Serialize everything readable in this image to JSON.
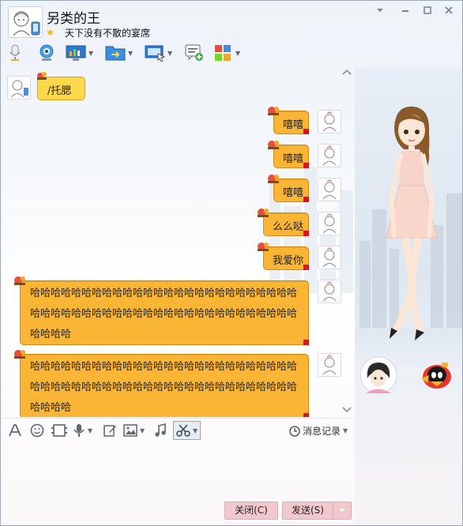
{
  "header": {
    "contact_name": "另类的王",
    "signature": "天下没有不散的宴席"
  },
  "window_controls": {
    "menu_icon": "chevron-down-icon",
    "minimize_icon": "minimize-icon",
    "maximize_icon": "maximize-icon",
    "close_icon": "close-icon"
  },
  "toolbar_icons": [
    "microphone-icon",
    "video-camera-icon",
    "remote-desktop-icon",
    "file-transfer-icon",
    "screen-share-icon",
    "add-chat-icon",
    "apps-icon"
  ],
  "chat": {
    "incoming_first": "/托腮",
    "messages_out": [
      {
        "text": "嘻嘻"
      },
      {
        "text": "嘻嘻"
      },
      {
        "text": "嘻嘻"
      },
      {
        "text": "么么哒"
      },
      {
        "text": "我爱你"
      }
    ],
    "long_messages": [
      {
        "lines": [
          "哈哈哈哈哈哈哈哈哈哈哈哈哈哈哈哈哈哈哈哈哈哈哈哈哈哈",
          "哈哈哈哈哈哈哈哈哈哈哈哈哈哈哈哈哈哈哈哈哈哈哈哈哈哈",
          "哈哈哈哈"
        ]
      },
      {
        "lines": [
          "哈哈哈哈哈哈哈哈哈哈哈哈哈哈哈哈哈哈哈哈哈哈哈哈哈哈",
          "哈哈哈哈哈哈哈哈哈哈哈哈哈哈哈哈哈哈哈哈哈哈哈哈哈哈",
          "哈哈哈哈"
        ]
      }
    ]
  },
  "input_toolbar": {
    "icons": [
      "font-icon",
      "emoji-icon",
      "gif-icon",
      "voice-message-icon",
      "edit-icon",
      "image-icon",
      "music-icon",
      "screenshot-scissors-icon"
    ],
    "message_record_label": "消息记录"
  },
  "buttons": {
    "close_label": "关闭(C)",
    "send_label": "发送(S)"
  },
  "colors": {
    "bubble": "#fbb534",
    "bubble_border": "#cf8a12",
    "button_pink": "#f1c9cc",
    "star": "#f2b400"
  }
}
